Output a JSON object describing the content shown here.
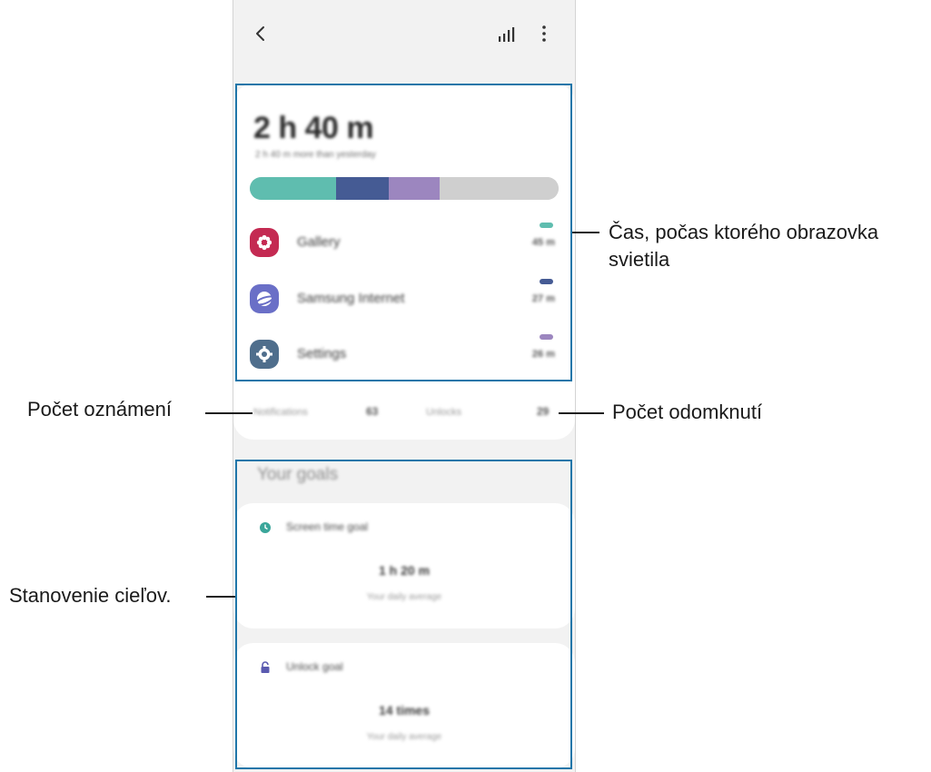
{
  "summary": {
    "total_time": "2 h 40 m",
    "comparison": "2 h 40 m more than yesterday",
    "bar_segments": [
      {
        "color": "#5fbdaf",
        "fraction": 0.28
      },
      {
        "color": "#455b94",
        "fraction": 0.17
      },
      {
        "color": "#9c86bf",
        "fraction": 0.165
      },
      {
        "color": "#cfcfcf",
        "fraction": 0.385
      }
    ]
  },
  "apps": [
    {
      "name": "Gallery",
      "duration": "45 m",
      "icon": "gallery-flower-icon",
      "icon_color": "#c42a52",
      "dot_color": "#5fbdaf"
    },
    {
      "name": "Samsung Internet",
      "duration": "27 m",
      "icon": "samsung-internet-icon",
      "icon_color": "#6a6fc7",
      "dot_color": "#455b94"
    },
    {
      "name": "Settings",
      "duration": "26 m",
      "icon": "settings-gear-icon",
      "icon_color": "#4f6e8c",
      "dot_color": "#9c86bf"
    }
  ],
  "stats": {
    "notifications_label": "Notifications",
    "notifications_value": "63",
    "unlocks_label": "Unlocks",
    "unlocks_value": "29"
  },
  "goals": {
    "title": "Your goals",
    "screen_time": {
      "name": "Screen time goal",
      "value": "1 h 20 m",
      "sub": "Your daily average",
      "icon": "clock-icon",
      "icon_color": "#3aa69a"
    },
    "unlock": {
      "name": "Unlock goal",
      "value": "14 times",
      "sub": "Your daily average",
      "icon": "unlock-icon",
      "icon_color": "#5a5ab0"
    }
  },
  "callouts": {
    "screen_time": "Čas, počas ktorého obrazovka svietila",
    "notifications": "Počet oznámení",
    "unlocks": "Počet odomknutí",
    "goals": "Stanovenie cieľov."
  },
  "colors": {
    "highlight": "#1f76a9",
    "background": "#f2f2f2"
  }
}
